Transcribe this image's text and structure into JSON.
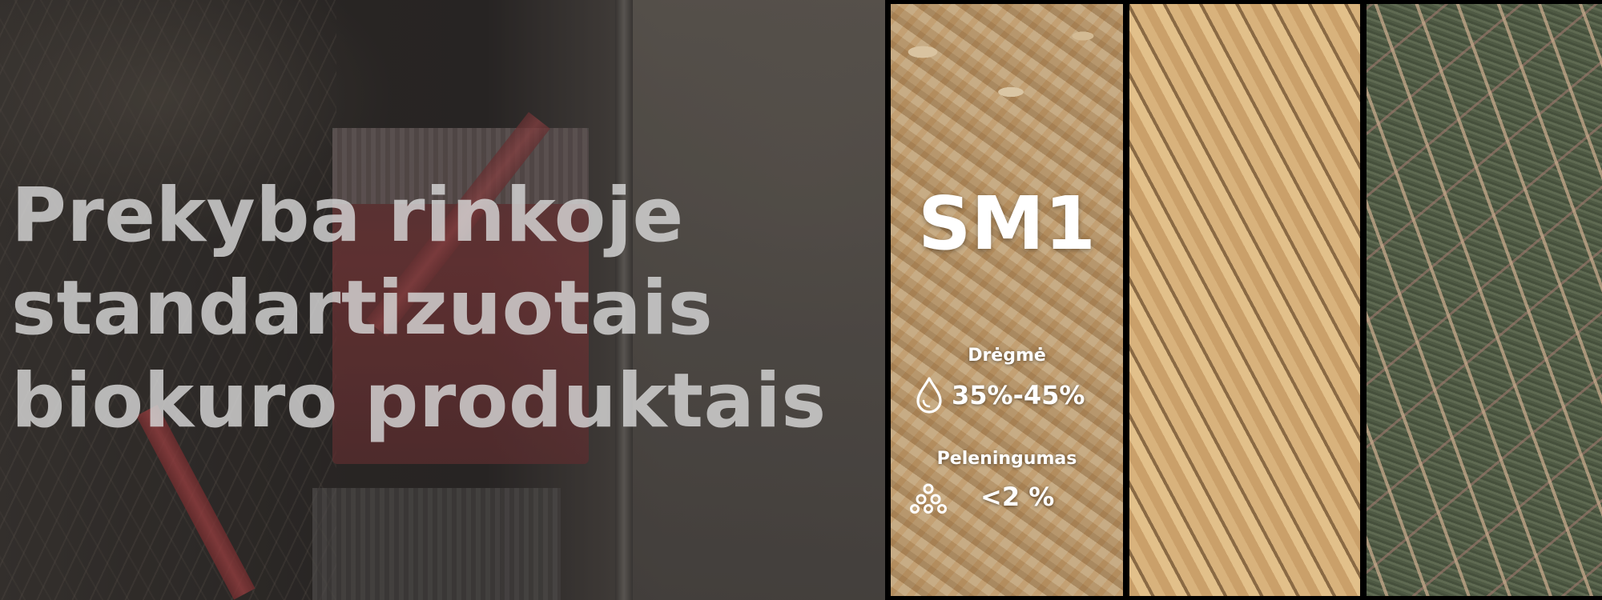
{
  "hero": {
    "headline_lines": [
      "Prekyba rinkoje",
      "standartizuotais",
      "biokuro produktais"
    ]
  },
  "products": [
    {
      "code": "SM1",
      "specs": {
        "moisture_label": "Drėgmė",
        "moisture_value": "35%-45%",
        "moisture_icon": "water-drop-icon",
        "ash_label": "Peleningumas",
        "ash_value": "<2 %",
        "ash_icon": "ash-pile-icon"
      }
    },
    {
      "code": ""
    },
    {
      "code": ""
    }
  ],
  "colors": {
    "headline": "#d7d7d7",
    "panel_text": "#ffffff",
    "divider": "#000000"
  }
}
